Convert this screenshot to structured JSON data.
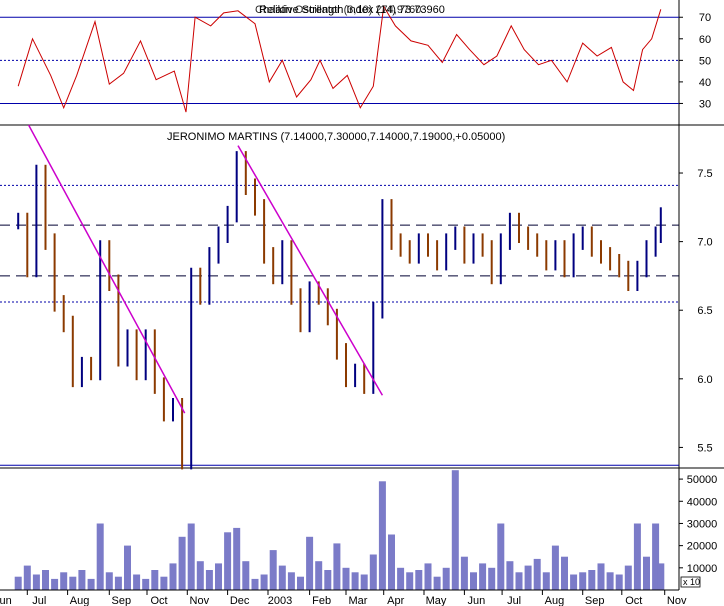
{
  "chart_data": [
    {
      "type": "line",
      "panel": "rsi",
      "title": "Relative Strength Index (14) 73.73960",
      "title_overlap": "Chaikin Oscillator (3,10) 274,9760",
      "ylim": [
        20,
        78
      ],
      "yticks": [
        "30",
        "40",
        "50",
        "60",
        "70"
      ],
      "levels": {
        "upper": 70,
        "middle": 50,
        "lower": 30
      },
      "series": [
        {
          "color": "#cc0000",
          "points": [
            [
              "2002-06-24",
              38
            ],
            [
              "2002-07-05",
              60
            ],
            [
              "2002-07-19",
              43
            ],
            [
              "2002-07-29",
              28
            ],
            [
              "2002-08-08",
              43
            ],
            [
              "2002-08-22",
              68
            ],
            [
              "2002-09-02",
              39
            ],
            [
              "2002-09-13",
              44
            ],
            [
              "2002-09-26",
              59
            ],
            [
              "2002-10-08",
              41
            ],
            [
              "2002-10-22",
              45
            ],
            [
              "2002-10-31",
              26
            ],
            [
              "2002-11-07",
              70
            ],
            [
              "2002-11-19",
              66
            ],
            [
              "2002-11-29",
              72
            ],
            [
              "2002-12-10",
              73
            ],
            [
              "2002-12-23",
              67
            ],
            [
              "2003-01-03",
              40
            ],
            [
              "2003-01-13",
              50
            ],
            [
              "2003-01-24",
              33
            ],
            [
              "2003-02-04",
              41
            ],
            [
              "2003-02-11",
              50
            ],
            [
              "2003-02-21",
              37
            ],
            [
              "2003-03-04",
              43
            ],
            [
              "2003-03-14",
              28
            ],
            [
              "2003-03-24",
              38
            ],
            [
              "2003-04-01",
              75
            ],
            [
              "2003-04-10",
              66
            ],
            [
              "2003-04-22",
              59
            ],
            [
              "2003-05-05",
              57
            ],
            [
              "2003-05-16",
              49
            ],
            [
              "2003-05-27",
              62
            ],
            [
              "2003-06-06",
              55
            ],
            [
              "2003-06-17",
              48
            ],
            [
              "2003-06-27",
              52
            ],
            [
              "2003-07-08",
              66
            ],
            [
              "2003-07-18",
              55
            ],
            [
              "2003-07-29",
              48
            ],
            [
              "2003-08-08",
              50
            ],
            [
              "2003-08-20",
              40
            ],
            [
              "2003-09-01",
              58
            ],
            [
              "2003-09-12",
              52
            ],
            [
              "2003-09-23",
              56
            ],
            [
              "2003-10-02",
              40
            ],
            [
              "2003-10-10",
              36
            ],
            [
              "2003-10-17",
              55
            ],
            [
              "2003-10-24",
              60
            ],
            [
              "2003-10-31",
              73.7
            ]
          ]
        }
      ]
    },
    {
      "type": "candlestick",
      "panel": "price",
      "title": "JERONIMO MARTINS (7.14000,7.30000,7.14000,7.19000,+0.05000)",
      "ylim": [
        5.35,
        7.85
      ],
      "yticks": [
        "5.5",
        "6.0",
        "6.5",
        "7.0",
        "7.5"
      ],
      "horizontal_levels": {
        "dotted": [
          7.41,
          6.56
        ],
        "dashed": [
          7.12,
          6.75
        ],
        "solid": [
          5.37
        ]
      },
      "trendlines": [
        {
          "color": "#cc00cc",
          "from": [
            "2002-07-02",
            7.85
          ],
          "to": [
            "2002-10-30",
            5.75
          ]
        },
        {
          "color": "#cc00cc",
          "from": [
            "2002-12-10",
            7.7
          ],
          "to": [
            "2003-03-31",
            5.88
          ]
        }
      ],
      "series": [
        {
          "name": "close",
          "up_color": "#000080",
          "down_color": "#8b3a00",
          "points": [
            [
              "2002-06-24",
              7.15
            ],
            [
              "2002-07-01",
              6.8
            ],
            [
              "2002-07-08",
              7.5
            ],
            [
              "2002-07-15",
              7.0
            ],
            [
              "2002-07-22",
              6.55
            ],
            [
              "2002-07-29",
              6.4
            ],
            [
              "2002-08-05",
              6.0
            ],
            [
              "2002-08-12",
              6.1
            ],
            [
              "2002-08-19",
              6.05
            ],
            [
              "2002-08-26",
              6.95
            ],
            [
              "2002-09-02",
              6.7
            ],
            [
              "2002-09-09",
              6.15
            ],
            [
              "2002-09-16",
              6.3
            ],
            [
              "2002-09-23",
              6.05
            ],
            [
              "2002-09-30",
              6.3
            ],
            [
              "2002-10-07",
              5.95
            ],
            [
              "2002-10-14",
              5.75
            ],
            [
              "2002-10-21",
              5.8
            ],
            [
              "2002-10-28",
              5.4
            ],
            [
              "2002-11-04",
              6.75
            ],
            [
              "2002-11-11",
              6.6
            ],
            [
              "2002-11-18",
              6.9
            ],
            [
              "2002-11-25",
              7.05
            ],
            [
              "2002-12-02",
              7.2
            ],
            [
              "2002-12-09",
              7.6
            ],
            [
              "2002-12-16",
              7.4
            ],
            [
              "2002-12-23",
              7.25
            ],
            [
              "2002-12-30",
              6.9
            ],
            [
              "2003-01-06",
              6.75
            ],
            [
              "2003-01-13",
              6.95
            ],
            [
              "2003-01-20",
              6.6
            ],
            [
              "2003-01-27",
              6.4
            ],
            [
              "2003-02-03",
              6.65
            ],
            [
              "2003-02-10",
              6.6
            ],
            [
              "2003-02-17",
              6.45
            ],
            [
              "2003-02-24",
              6.2
            ],
            [
              "2003-03-03",
              6.0
            ],
            [
              "2003-03-10",
              6.05
            ],
            [
              "2003-03-17",
              5.95
            ],
            [
              "2003-03-24",
              6.5
            ],
            [
              "2003-03-31",
              7.25
            ],
            [
              "2003-04-07",
              7.0
            ],
            [
              "2003-04-14",
              6.95
            ],
            [
              "2003-04-21",
              6.9
            ],
            [
              "2003-04-28",
              7.0
            ],
            [
              "2003-05-05",
              6.95
            ],
            [
              "2003-05-12",
              6.85
            ],
            [
              "2003-05-19",
              7.0
            ],
            [
              "2003-05-26",
              7.05
            ],
            [
              "2003-06-02",
              6.9
            ],
            [
              "2003-06-09",
              7.0
            ],
            [
              "2003-06-16",
              6.95
            ],
            [
              "2003-06-23",
              6.75
            ],
            [
              "2003-06-30",
              7.0
            ],
            [
              "2003-07-07",
              7.15
            ],
            [
              "2003-07-14",
              7.05
            ],
            [
              "2003-07-21",
              7.0
            ],
            [
              "2003-07-28",
              6.95
            ],
            [
              "2003-08-04",
              6.85
            ],
            [
              "2003-08-11",
              6.95
            ],
            [
              "2003-08-18",
              6.8
            ],
            [
              "2003-08-25",
              7.0
            ],
            [
              "2003-09-01",
              7.05
            ],
            [
              "2003-09-08",
              6.95
            ],
            [
              "2003-09-15",
              6.9
            ],
            [
              "2003-09-22",
              6.85
            ],
            [
              "2003-09-29",
              6.8
            ],
            [
              "2003-10-06",
              6.7
            ],
            [
              "2003-10-13",
              6.8
            ],
            [
              "2003-10-20",
              6.95
            ],
            [
              "2003-10-27",
              7.05
            ],
            [
              "2003-10-31",
              7.19
            ]
          ]
        }
      ]
    },
    {
      "type": "bar",
      "panel": "volume",
      "ylim": [
        0,
        55000
      ],
      "yticks": [
        "10000",
        "20000",
        "30000",
        "40000",
        "50000"
      ],
      "unit_label": "x 10",
      "series": [
        {
          "color": "#7b7bc8",
          "points": [
            [
              "2002-06-24",
              6000
            ],
            [
              "2002-07-01",
              11000
            ],
            [
              "2002-07-08",
              7000
            ],
            [
              "2002-07-15",
              9000
            ],
            [
              "2002-07-22",
              5000
            ],
            [
              "2002-07-29",
              8000
            ],
            [
              "2002-08-05",
              6000
            ],
            [
              "2002-08-12",
              9000
            ],
            [
              "2002-08-19",
              5000
            ],
            [
              "2002-08-26",
              30000
            ],
            [
              "2002-09-02",
              8000
            ],
            [
              "2002-09-09",
              6000
            ],
            [
              "2002-09-16",
              20000
            ],
            [
              "2002-09-23",
              7000
            ],
            [
              "2002-09-30",
              5000
            ],
            [
              "2002-10-07",
              9000
            ],
            [
              "2002-10-14",
              6000
            ],
            [
              "2002-10-21",
              12000
            ],
            [
              "2002-10-28",
              24000
            ],
            [
              "2002-11-04",
              30000
            ],
            [
              "2002-11-11",
              13000
            ],
            [
              "2002-11-18",
              9000
            ],
            [
              "2002-11-25",
              12000
            ],
            [
              "2002-12-02",
              26000
            ],
            [
              "2002-12-09",
              28000
            ],
            [
              "2002-12-16",
              13000
            ],
            [
              "2002-12-23",
              5000
            ],
            [
              "2002-12-30",
              7000
            ],
            [
              "2003-01-06",
              18000
            ],
            [
              "2003-01-13",
              11000
            ],
            [
              "2003-01-20",
              8000
            ],
            [
              "2003-01-27",
              6000
            ],
            [
              "2003-02-03",
              24000
            ],
            [
              "2003-02-10",
              13000
            ],
            [
              "2003-02-17",
              9000
            ],
            [
              "2003-02-24",
              21000
            ],
            [
              "2003-03-03",
              10000
            ],
            [
              "2003-03-10",
              8000
            ],
            [
              "2003-03-17",
              7000
            ],
            [
              "2003-03-24",
              16000
            ],
            [
              "2003-03-31",
              49000
            ],
            [
              "2003-04-07",
              25000
            ],
            [
              "2003-04-14",
              10000
            ],
            [
              "2003-04-21",
              8000
            ],
            [
              "2003-04-28",
              9000
            ],
            [
              "2003-05-05",
              12000
            ],
            [
              "2003-05-12",
              6000
            ],
            [
              "2003-05-19",
              10000
            ],
            [
              "2003-05-26",
              54000
            ],
            [
              "2003-06-02",
              15000
            ],
            [
              "2003-06-09",
              8000
            ],
            [
              "2003-06-16",
              12000
            ],
            [
              "2003-06-23",
              10000
            ],
            [
              "2003-06-30",
              30000
            ],
            [
              "2003-07-07",
              13000
            ],
            [
              "2003-07-14",
              8000
            ],
            [
              "2003-07-21",
              11000
            ],
            [
              "2003-07-28",
              14000
            ],
            [
              "2003-08-04",
              8000
            ],
            [
              "2003-08-11",
              20000
            ],
            [
              "2003-08-18",
              15000
            ],
            [
              "2003-08-25",
              7000
            ],
            [
              "2003-09-01",
              8000
            ],
            [
              "2003-09-08",
              9000
            ],
            [
              "2003-09-15",
              12000
            ],
            [
              "2003-09-22",
              8000
            ],
            [
              "2003-09-29",
              7000
            ],
            [
              "2003-10-06",
              11000
            ],
            [
              "2003-10-13",
              30000
            ],
            [
              "2003-10-20",
              15000
            ],
            [
              "2003-10-27",
              30000
            ],
            [
              "2003-10-31",
              12000
            ]
          ]
        }
      ]
    }
  ],
  "x_axis": {
    "ticks": [
      {
        "label": "Jun",
        "date": "2002-06-03"
      },
      {
        "label": "Jul",
        "date": "2002-07-01"
      },
      {
        "label": "Aug",
        "date": "2002-08-01"
      },
      {
        "label": "Sep",
        "date": "2002-09-02"
      },
      {
        "label": "Oct",
        "date": "2002-10-01"
      },
      {
        "label": "Nov",
        "date": "2002-11-01"
      },
      {
        "label": "Dec",
        "date": "2002-12-02"
      },
      {
        "label": "2003",
        "date": "2003-01-02"
      },
      {
        "label": "Feb",
        "date": "2003-02-03"
      },
      {
        "label": "Mar",
        "date": "2003-03-03"
      },
      {
        "label": "Apr",
        "date": "2003-04-01"
      },
      {
        "label": "May",
        "date": "2003-05-02"
      },
      {
        "label": "Jun",
        "date": "2003-06-02"
      },
      {
        "label": "Jul",
        "date": "2003-07-01"
      },
      {
        "label": "Aug",
        "date": "2003-08-01"
      },
      {
        "label": "Sep",
        "date": "2003-09-01"
      },
      {
        "label": "Oct",
        "date": "2003-10-01"
      },
      {
        "label": "Nov",
        "date": "2003-11-03"
      }
    ]
  },
  "colors": {
    "axis": "#000000",
    "grid": "#0000aa",
    "rsi_line": "#cc0000",
    "trendline": "#cc00cc",
    "volume": "#7b7bc8"
  }
}
